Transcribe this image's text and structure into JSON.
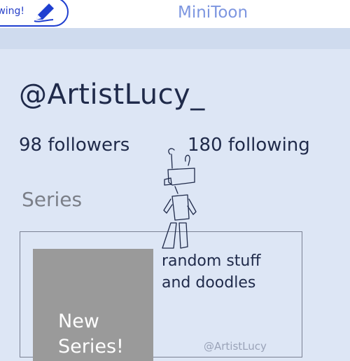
{
  "header": {
    "draw_button_label": "rawing!",
    "draw_icon": "pencil-icon",
    "app_title": "MiniToon"
  },
  "profile": {
    "username": "@ArtistLucy_",
    "followers": "98 followers",
    "following": "180 following"
  },
  "series_section": {
    "title": "Series",
    "items": [
      {
        "cover_text": "New\nSeries!",
        "description": "random stuff\nand doodles",
        "author": "@ArtistLucy"
      }
    ]
  },
  "colors": {
    "background": "#dde6f5",
    "accent": "#2740c8",
    "title": "#7d96e0",
    "text": "#1f2a4a",
    "cover": "#9a9a9a"
  }
}
